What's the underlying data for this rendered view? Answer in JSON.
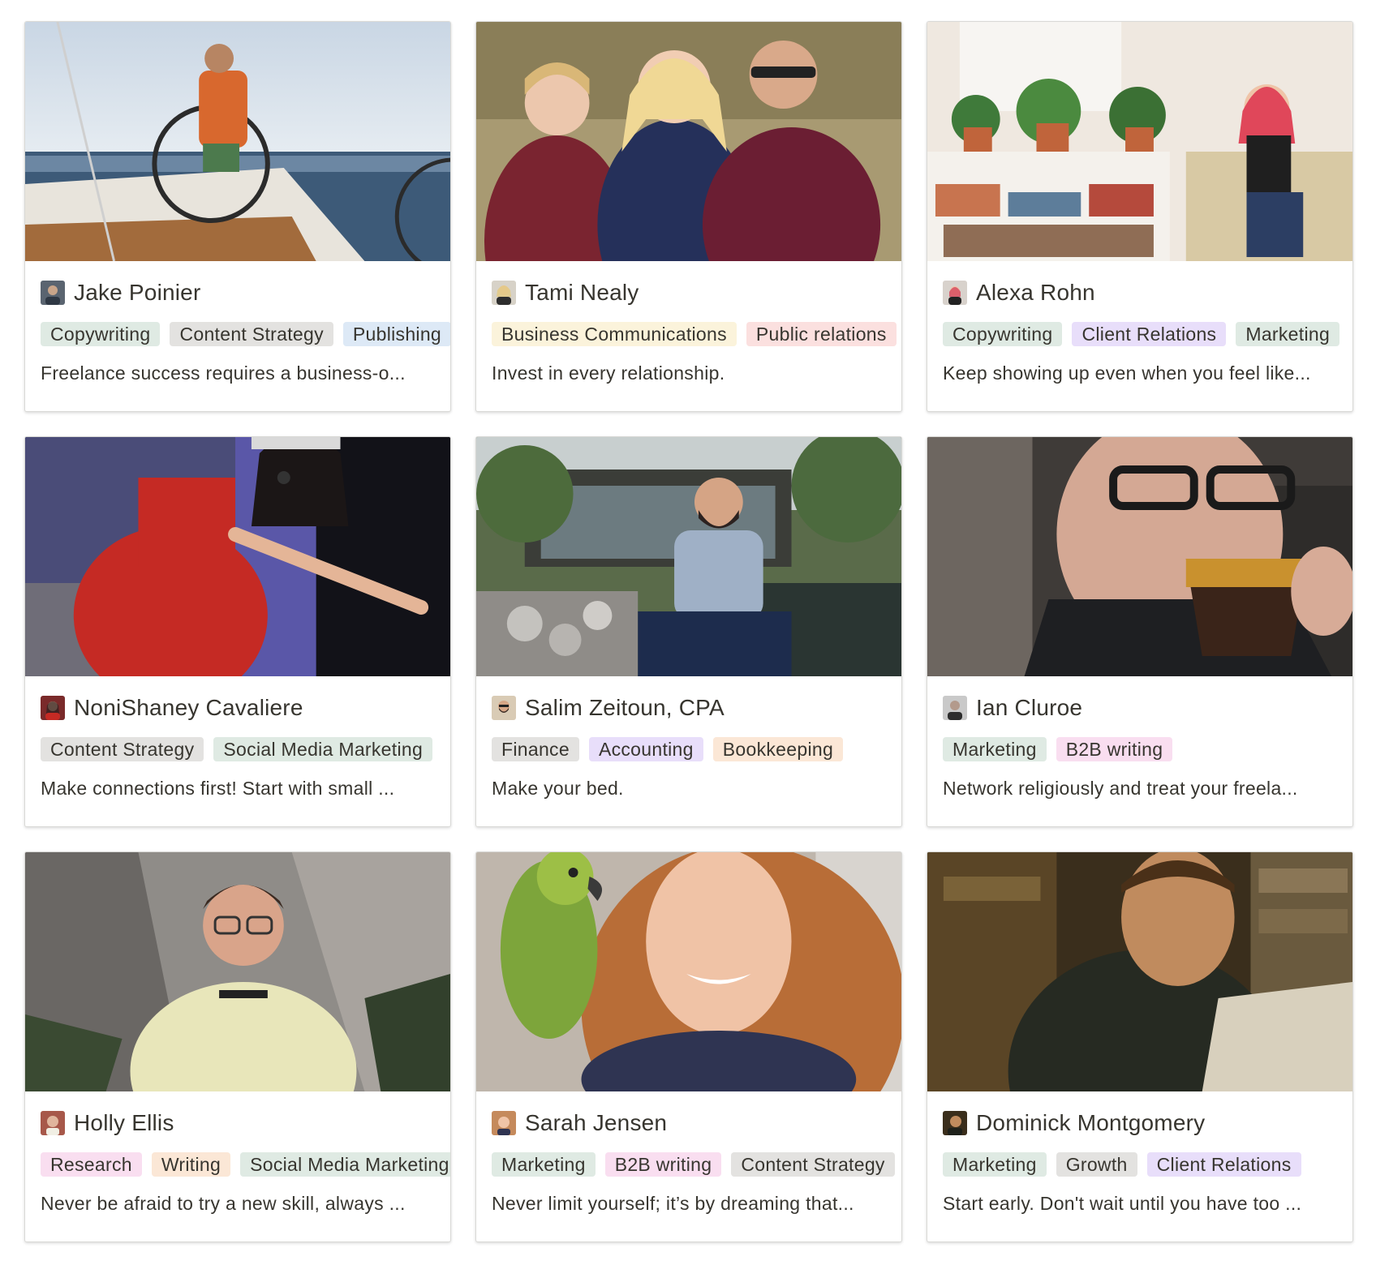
{
  "colors": {
    "green": "#dfeae3",
    "gray": "#e3e2e0",
    "blue": "#dde9f6",
    "orange": "#fbe7d6",
    "yellow": "#fbf3db",
    "red": "#fbe0df",
    "purple": "#e8defa",
    "pink": "#f9def0"
  },
  "cards": [
    {
      "name": "Jake Poinier",
      "avatar_icon": "person-avatar-icon",
      "cover": "sailing-photo",
      "tags": [
        {
          "label": "Copywriting",
          "color": "green"
        },
        {
          "label": "Content Strategy",
          "color": "gray"
        },
        {
          "label": "Publishing",
          "color": "blue"
        }
      ],
      "summary": "Freelance success requires a business-o..."
    },
    {
      "name": "Tami Nealy",
      "avatar_icon": "person-avatar-icon",
      "cover": "family-photo",
      "tags": [
        {
          "label": "Business Communications",
          "color": "yellow"
        },
        {
          "label": "Public relations",
          "color": "red"
        }
      ],
      "summary": "Invest in every relationship."
    },
    {
      "name": "Alexa Rohn",
      "avatar_icon": "person-avatar-icon",
      "cover": "plants-shelf-photo",
      "tags": [
        {
          "label": "Copywriting",
          "color": "green"
        },
        {
          "label": "Client Relations",
          "color": "purple"
        },
        {
          "label": "Marketing",
          "color": "green"
        }
      ],
      "summary": "Keep showing up even when you feel like..."
    },
    {
      "name": "NoniShaney Cavaliere",
      "avatar_icon": "person-avatar-icon",
      "cover": "stage-performer-photo",
      "tags": [
        {
          "label": "Content Strategy",
          "color": "gray"
        },
        {
          "label": "Social Media Marketing",
          "color": "green"
        }
      ],
      "summary": "Make connections first! Start with small ..."
    },
    {
      "name": "Salim Zeitoun, CPA",
      "avatar_icon": "person-avatar-icon",
      "cover": "garden-pond-photo",
      "tags": [
        {
          "label": "Finance",
          "color": "gray"
        },
        {
          "label": "Accounting",
          "color": "purple"
        },
        {
          "label": "Bookkeeping",
          "color": "orange"
        }
      ],
      "summary": "Make your bed."
    },
    {
      "name": "Ian Cluroe",
      "avatar_icon": "person-avatar-icon",
      "cover": "coffee-drinker-photo",
      "tags": [
        {
          "label": "Marketing",
          "color": "green"
        },
        {
          "label": "B2B writing",
          "color": "pink"
        }
      ],
      "summary": "Network religiously and treat your freela..."
    },
    {
      "name": "Holly Ellis",
      "avatar_icon": "person-avatar-icon",
      "cover": "mountain-portrait-photo",
      "tags": [
        {
          "label": "Research",
          "color": "pink"
        },
        {
          "label": "Writing",
          "color": "orange"
        },
        {
          "label": "Social Media Marketing",
          "color": "green"
        }
      ],
      "summary": "Never be afraid to try a new skill, always ..."
    },
    {
      "name": "Sarah Jensen",
      "avatar_icon": "person-avatar-icon",
      "cover": "parrot-selfie-photo",
      "tags": [
        {
          "label": "Marketing",
          "color": "green"
        },
        {
          "label": "B2B writing",
          "color": "pink"
        },
        {
          "label": "Content Strategy",
          "color": "gray"
        }
      ],
      "summary": "Never limit yourself; it’s by dreaming that..."
    },
    {
      "name": "Dominick Montgomery",
      "avatar_icon": "person-avatar-icon",
      "cover": "laptop-library-photo",
      "tags": [
        {
          "label": "Marketing",
          "color": "green"
        },
        {
          "label": "Growth",
          "color": "gray"
        },
        {
          "label": "Client Relations",
          "color": "purple"
        }
      ],
      "summary": "Start early. Don't wait until you have too ..."
    }
  ]
}
